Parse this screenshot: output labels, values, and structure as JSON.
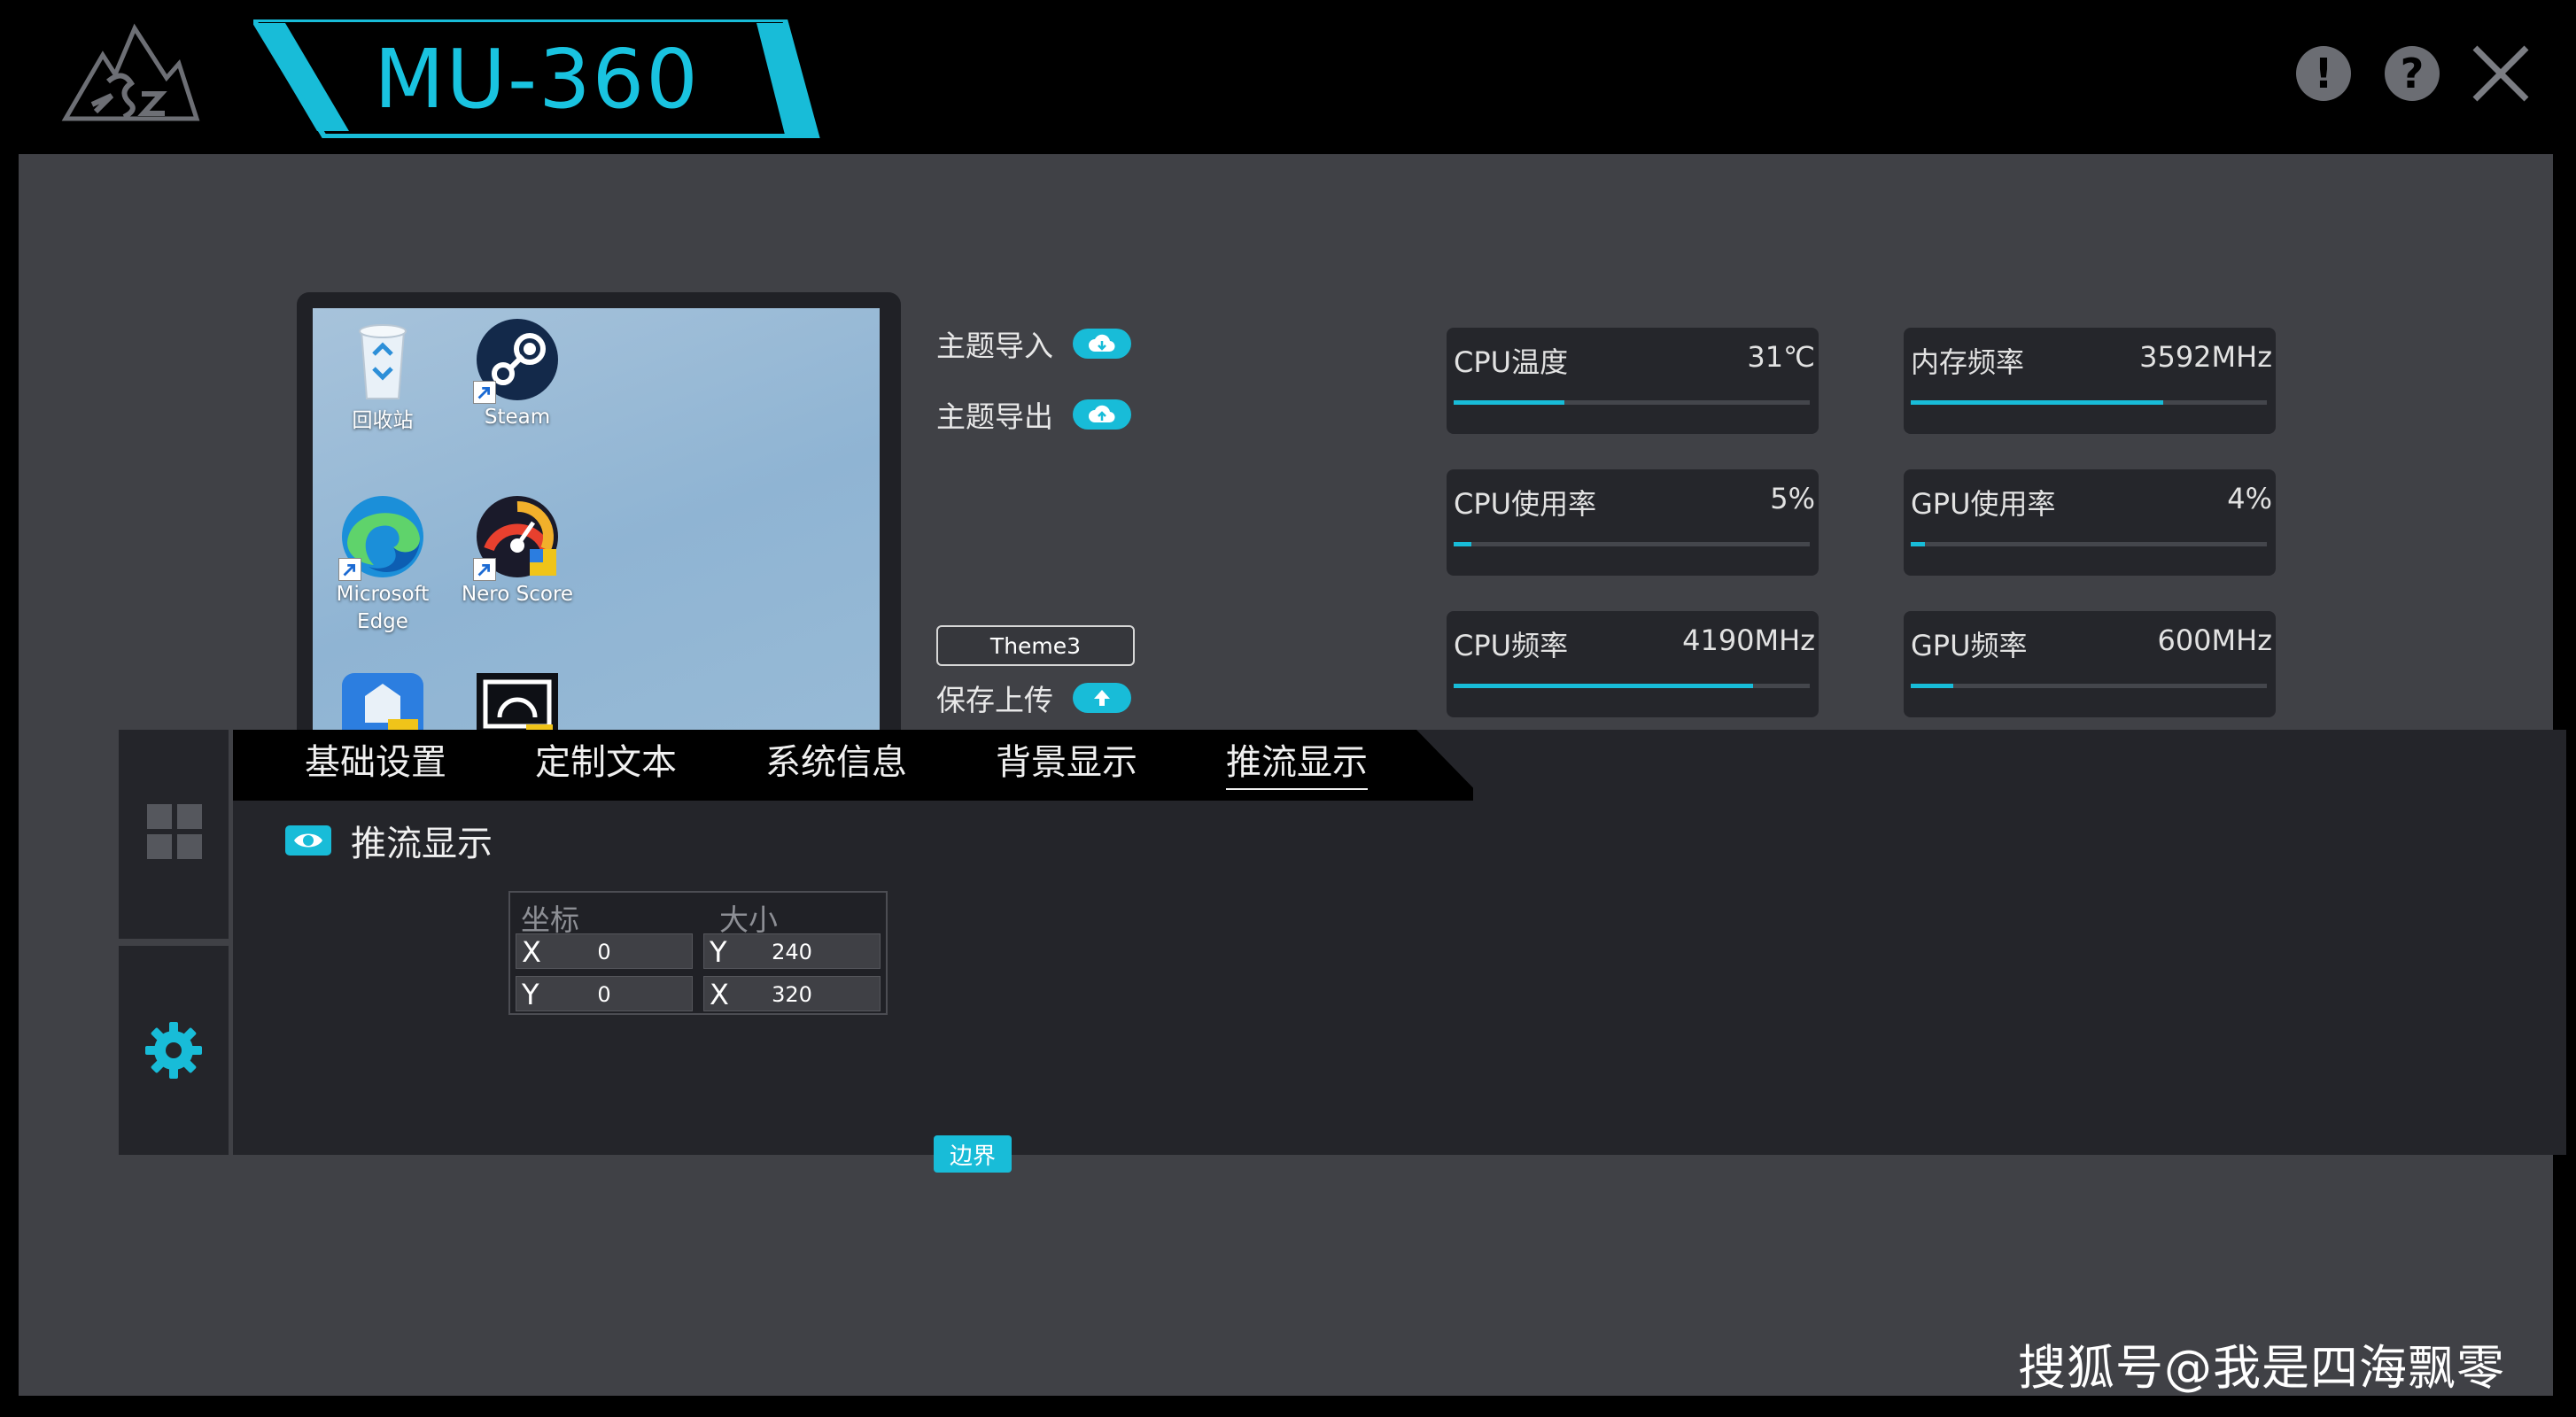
{
  "app": {
    "title": "MU-360"
  },
  "window_buttons": {
    "info": "!",
    "help": "?"
  },
  "preview": {
    "icons": [
      {
        "label": "回收站",
        "icon": "recycle-bin-icon"
      },
      {
        "label": "Steam",
        "icon": "steam-icon"
      },
      {
        "label": "Microsoft Edge",
        "icon": "edge-icon"
      },
      {
        "label": "Nero Score",
        "icon": "nero-score-icon"
      },
      {
        "label": "",
        "icon": "app-tool-icon"
      },
      {
        "label": "",
        "icon": "app-monitor-icon"
      }
    ]
  },
  "theme": {
    "import_label": "主题导入",
    "export_label": "主题导出",
    "name": "Theme3",
    "save_upload_label": "保存上传"
  },
  "monitors": [
    {
      "name": "CPU温度",
      "value": "31℃",
      "level": 0.31
    },
    {
      "name": "内存频率",
      "value": "3592MHz",
      "level": 0.71
    },
    {
      "name": "CPU使用率",
      "value": "5%",
      "level": 0.05
    },
    {
      "name": "GPU使用率",
      "value": "4%",
      "level": 0.04
    },
    {
      "name": "CPU频率",
      "value": "4190MHz",
      "level": 0.84
    },
    {
      "name": "GPU频率",
      "value": "600MHz",
      "level": 0.12
    }
  ],
  "tabs": [
    {
      "label": "基础设置"
    },
    {
      "label": "定制文本"
    },
    {
      "label": "系统信息"
    },
    {
      "label": "背景显示"
    },
    {
      "label": "推流显示",
      "active": true
    }
  ],
  "stream": {
    "toggle_label": "推流显示",
    "coord_label": "坐标",
    "size_label": "大小",
    "coord_x_axis": "X",
    "coord_x": "0",
    "coord_y_axis": "Y",
    "coord_y": "0",
    "size_y_axis": "Y",
    "size_y": "240",
    "size_x_axis": "X",
    "size_x": "320",
    "edge_button": "边界"
  },
  "watermark": "搜狐号@我是四海飘零",
  "colors": {
    "accent": "#18bcd8",
    "panel": "#404146",
    "dark": "#24252a"
  }
}
